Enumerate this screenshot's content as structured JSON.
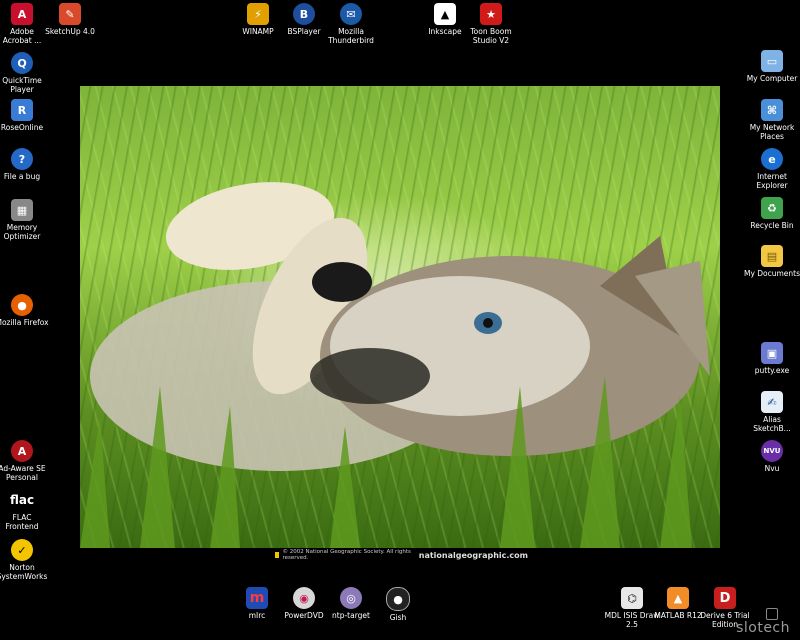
{
  "colors": {
    "desktop_background": "#000000",
    "label_color": "#ffffff"
  },
  "desktop_icons": {
    "adobe_acrobat": {
      "label": "Adobe\nAcrobat ...",
      "icon": "adobe-acrobat-icon"
    },
    "sketchup": {
      "label": "SketchUp 4.0",
      "icon": "sketchup-icon"
    },
    "winamp": {
      "label": "WINAMP",
      "icon": "winamp-icon"
    },
    "bsplayer": {
      "label": "BSPlayer",
      "icon": "bsplayer-icon"
    },
    "thunderbird": {
      "label": "Mozilla\nThunderbird",
      "icon": "thunderbird-icon"
    },
    "inkscape": {
      "label": "Inkscape",
      "icon": "inkscape-icon"
    },
    "toon_boom": {
      "label": "Toon Boom\nStudio V2",
      "icon": "toon-boom-icon"
    },
    "quicktime": {
      "label": "QuickTime\nPlayer",
      "icon": "quicktime-icon"
    },
    "roseonline": {
      "label": "RoseOnline",
      "icon": "roseonline-icon"
    },
    "file_a_bug": {
      "label": "File a bug",
      "icon": "help-icon"
    },
    "memory_optimizer": {
      "label": "Memory\nOptimizer",
      "icon": "memory-chip-icon"
    },
    "firefox": {
      "label": "Mozilla Firefox",
      "icon": "firefox-icon"
    },
    "adaware": {
      "label": "Ad-Aware SE\nPersonal",
      "icon": "adaware-icon"
    },
    "flac": {
      "label": "FLAC\nFrontend",
      "icon": "flac-icon",
      "glyph_text": "flac"
    },
    "norton": {
      "label": "Norton\nSystemWorks",
      "icon": "norton-icon"
    },
    "my_computer": {
      "label": "My Computer",
      "icon": "computer-icon"
    },
    "network_places": {
      "label": "My Network\nPlaces",
      "icon": "network-icon"
    },
    "internet_explorer": {
      "label": "Internet\nExplorer",
      "icon": "internet-explorer-icon"
    },
    "recycle_bin": {
      "label": "Recycle Bin",
      "icon": "recycle-bin-icon"
    },
    "my_documents": {
      "label": "My Documents",
      "icon": "folder-icon"
    },
    "putty": {
      "label": "putty.exe",
      "icon": "putty-icon"
    },
    "alias_sketchbook": {
      "label": "Alias\nSketchB...",
      "icon": "sketchbook-icon"
    },
    "nvu": {
      "label": "Nvu",
      "icon": "nvu-icon",
      "glyph_text": "NVU"
    },
    "mirc": {
      "label": "mIrc",
      "icon": "mirc-icon",
      "glyph_text": "m"
    },
    "powerdvd": {
      "label": "PowerDVD",
      "icon": "powerdvd-icon"
    },
    "ntp_target": {
      "label": "ntp-target",
      "icon": "ntp-target-icon"
    },
    "gish": {
      "label": "Gish",
      "icon": "gish-icon"
    },
    "mdl_isis": {
      "label": "MDL ISIS Draw\n2.5",
      "icon": "isis-draw-icon"
    },
    "matlab": {
      "label": "MATLAB R12",
      "icon": "matlab-icon"
    },
    "derive": {
      "label": "Derive 6 Trial\nEdition",
      "icon": "derive-icon",
      "glyph_text": "D"
    }
  },
  "wallpaper": {
    "copyright": "© 2002 National Geographic Society. All rights reserved.",
    "website": "nationalgeographic.com"
  },
  "watermark": "slotech"
}
